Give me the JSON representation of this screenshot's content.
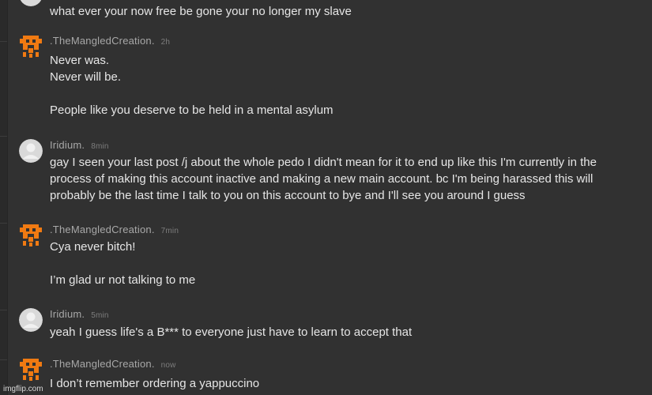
{
  "thread": {
    "top_message": "what ever your now free be gone your no longer my slave",
    "messages": [
      {
        "author": ".TheMangledCreation.",
        "time": "2h",
        "text": "Never was.\nNever will be.\n\nPeople like you deserve to be held in a mental asylum"
      },
      {
        "author": "Iridium.",
        "time": "8min",
        "text": "gay I seen your last post /j about the whole pedo I didn't mean for it to end up like this I'm currently in the process of making this account inactive and making a new main account. bc I'm being harassed this will probably be the last time I talk to you on this account to bye and I'll see you around I guess"
      },
      {
        "author": ".TheMangledCreation.",
        "time": "7min",
        "text": "Cya never bitch!\n\nI’m glad ur not talking to me"
      },
      {
        "author": "Iridium.",
        "time": "5min",
        "text": "yeah I guess life's a B*** to everyone just have to learn to accept that"
      },
      {
        "author": ".TheMangledCreation.",
        "time": "now",
        "text": "I don’t remember ordering a yappuccino"
      }
    ]
  },
  "watermark": "imgflip.com",
  "colors": {
    "background": "#313131",
    "text": "#e6e6e6",
    "username": "#a8a8a8",
    "timestamp": "#7d7d7d",
    "pixel_avatar": "#f07a12",
    "default_avatar": "#d9d9d9"
  },
  "icons": {
    "pixel_avatar": "orange-pixel-skull-icon",
    "default_avatar": "default-user-icon"
  }
}
